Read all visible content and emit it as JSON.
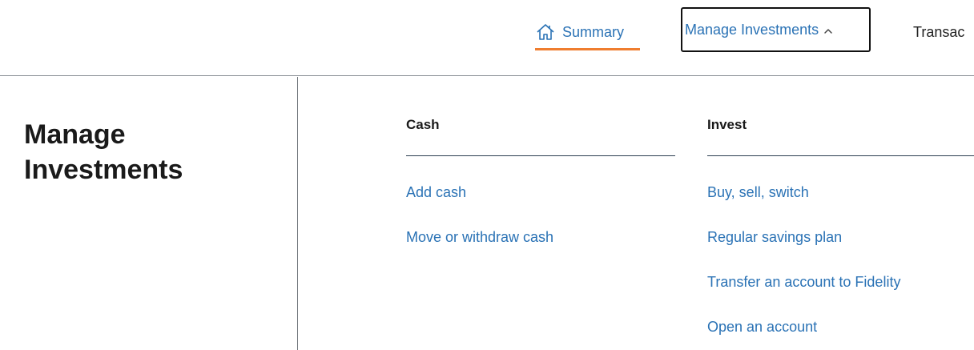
{
  "nav": {
    "summary_label": "Summary",
    "manage_label": "Manage Investments",
    "transactions_label": "Transac"
  },
  "colors": {
    "link": "#2a72b5",
    "active_underline": "#ef7d2f",
    "text": "#1a1a1a"
  },
  "icons": {
    "summary": "home-icon",
    "manage": "chevron-up-icon"
  },
  "panel": {
    "title": "Manage Investments",
    "columns": [
      {
        "heading": "Cash",
        "links": [
          "Add cash",
          "Move or withdraw cash"
        ]
      },
      {
        "heading": "Invest",
        "links": [
          "Buy, sell, switch",
          "Regular savings plan",
          "Transfer an account to Fidelity",
          "Open an account"
        ]
      }
    ]
  }
}
